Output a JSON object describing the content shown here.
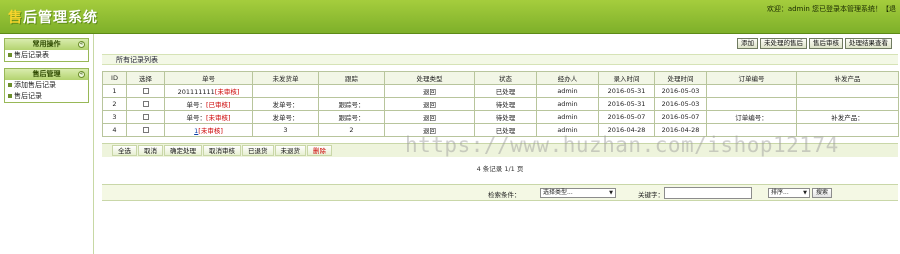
{
  "header": {
    "title_first": "售",
    "title_rest": "后管理系统",
    "welcome": "欢迎：admin 您已登录本管理系统！【退"
  },
  "sidebar": {
    "panels": [
      {
        "title": "常用操作",
        "items": [
          "售后记录表"
        ]
      },
      {
        "title": "售后管理",
        "items": [
          "添加售后记录",
          "售后记录"
        ]
      }
    ]
  },
  "toolbar": {
    "buttons": [
      "添加",
      "未处理的售后",
      "售后审核",
      "处理结果查看"
    ]
  },
  "list_title": "所有记录列表",
  "table": {
    "columns": [
      "ID",
      "选择",
      "单号",
      "未发货单",
      "跟踪",
      "处理类型",
      "状态",
      "经办人",
      "录入时间",
      "处理时间",
      "订单编号",
      "补发产品"
    ],
    "rows": [
      {
        "id": "1",
        "order": "201111111",
        "order_tag": "[未审核]",
        "unsent": "",
        "track": "",
        "type": "退回",
        "status": "已处理",
        "handler": "admin",
        "entered": "2016-05-31",
        "handled": "2016-05-03",
        "order_no": "",
        "product": ""
      },
      {
        "id": "2",
        "order": "单号：",
        "order_tag": "[已审核]",
        "unsent": "发单号：",
        "track": "跟踪号：",
        "type": "退回",
        "status": "待处理",
        "handler": "admin",
        "entered": "2016-05-31",
        "handled": "2016-05-03",
        "order_no": "",
        "product": ""
      },
      {
        "id": "3",
        "order": "单号：",
        "order_tag": "[未审核]",
        "unsent": "发单号：",
        "track": "跟踪号：",
        "type": "退回",
        "status": "待处理",
        "handler": "admin",
        "entered": "2016-05-07",
        "handled": "2016-05-07",
        "order_no": "订单编号：",
        "product": "补发产品："
      },
      {
        "id": "4",
        "order": "1",
        "order_tag": "[未审核]",
        "unsent": "3",
        "track": "2",
        "type": "退回",
        "status": "已处理",
        "handler": "admin",
        "entered": "2016-04-28",
        "handled": "2016-04-28",
        "order_no": "",
        "product": ""
      }
    ]
  },
  "bulk_buttons": [
    "全选",
    "取消",
    "确定处理",
    "取消审核",
    "已退货",
    "未退货",
    "删除"
  ],
  "pager": "4 条记录 1/1 页",
  "search": {
    "condition_label": "检索条件：",
    "condition_value": "选择类型...",
    "keyword_label": "关键字：",
    "keyword_value": "",
    "sort_value": "排序...",
    "search_button": "搜索"
  },
  "watermark": "https://www.huzhan.com/ishop12174"
}
